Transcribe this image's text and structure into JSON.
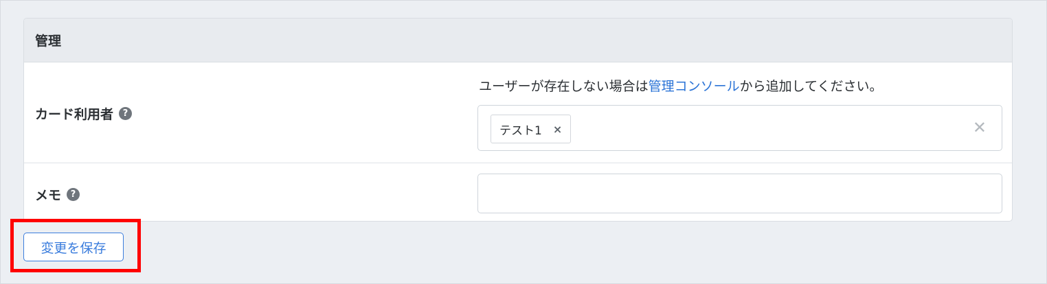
{
  "section": {
    "title": "管理"
  },
  "card_user": {
    "label": "カード利用者",
    "help_icon": "question-circle-icon",
    "hint_prefix": "ユーザーが存在しない場合は",
    "hint_link": "管理コンソール",
    "hint_suffix": "から追加してください。",
    "selected_tag": "テスト1",
    "tag_remove_glyph": "×",
    "clear_glyph": "✕"
  },
  "memo": {
    "label": "メモ",
    "help_icon": "question-circle-icon",
    "value": "",
    "placeholder": ""
  },
  "actions": {
    "save_label": "変更を保存"
  },
  "colors": {
    "accent": "#3b7ddd",
    "link": "#2a73d6",
    "highlight": "#ff0000",
    "background": "#eceff3"
  }
}
